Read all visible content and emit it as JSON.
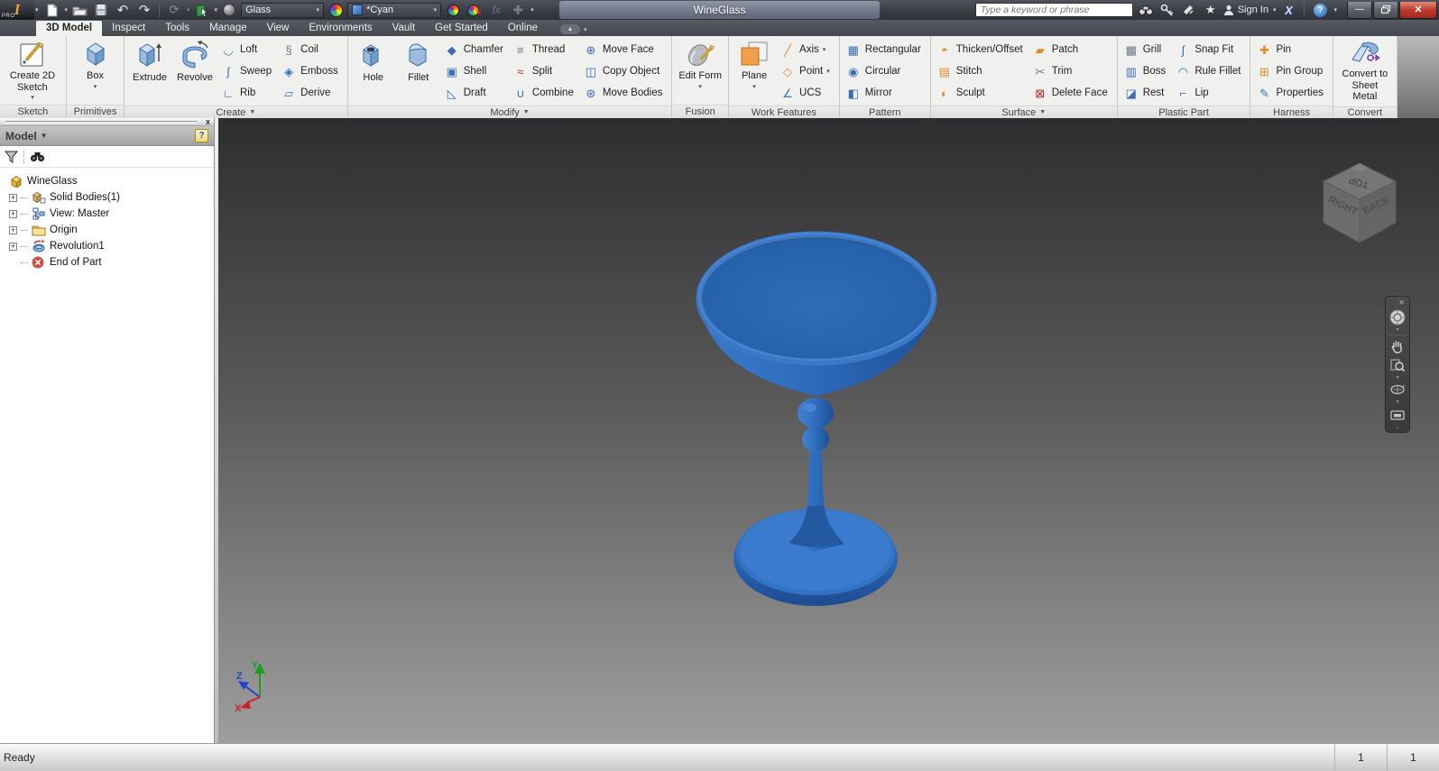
{
  "titlebar": {
    "logo": "I",
    "logo_sub": "PRO",
    "document_title": "WineGlass",
    "material_value": "Glass",
    "appearance_value": "*Cyan",
    "fx_label": "fx",
    "search_placeholder": "Type a keyword or phrase",
    "sign_in_label": "Sign In",
    "exchange_label": "X",
    "help_label": "?"
  },
  "tabs": {
    "items": [
      {
        "label": "3D Model",
        "active": true
      },
      {
        "label": "Inspect"
      },
      {
        "label": "Tools"
      },
      {
        "label": "Manage"
      },
      {
        "label": "View"
      },
      {
        "label": "Environments"
      },
      {
        "label": "Vault"
      },
      {
        "label": "Get Started"
      },
      {
        "label": "Online"
      }
    ]
  },
  "ribbon": {
    "panels": [
      {
        "label": "Sketch",
        "big": [
          {
            "label": "Create 2D Sketch",
            "icon": "create-2d-sketch-icon"
          }
        ]
      },
      {
        "label": "Primitives",
        "big": [
          {
            "label": "Box",
            "icon": "box-icon"
          }
        ]
      },
      {
        "label": "Create",
        "arrow": "▼",
        "big": [
          {
            "label": "Extrude",
            "icon": "extrude-icon"
          },
          {
            "label": "Revolve",
            "icon": "revolve-icon"
          }
        ],
        "cols": [
          [
            {
              "label": "Loft",
              "icon": "loft-icon"
            },
            {
              "label": "Sweep",
              "icon": "sweep-icon"
            },
            {
              "label": "Rib",
              "icon": "rib-icon"
            }
          ],
          [
            {
              "label": "Coil",
              "icon": "coil-icon"
            },
            {
              "label": "Emboss",
              "icon": "emboss-icon"
            },
            {
              "label": "Derive",
              "icon": "derive-icon"
            }
          ]
        ]
      },
      {
        "label": "Modify",
        "arrow": "▼",
        "big": [
          {
            "label": "Hole",
            "icon": "hole-icon"
          },
          {
            "label": "Fillet",
            "icon": "fillet-icon"
          }
        ],
        "cols": [
          [
            {
              "label": "Chamfer",
              "icon": "chamfer-icon"
            },
            {
              "label": "Shell",
              "icon": "shell-icon"
            },
            {
              "label": "Draft",
              "icon": "draft-icon"
            }
          ],
          [
            {
              "label": "Thread",
              "icon": "thread-icon"
            },
            {
              "label": "Split",
              "icon": "split-icon"
            },
            {
              "label": "Combine",
              "icon": "combine-icon"
            }
          ],
          [
            {
              "label": "Move Face",
              "icon": "move-face-icon"
            },
            {
              "label": "Copy Object",
              "icon": "copy-object-icon"
            },
            {
              "label": "Move Bodies",
              "icon": "move-bodies-icon"
            }
          ]
        ]
      },
      {
        "label": "Fusion",
        "big": [
          {
            "label": "Edit Form",
            "arrow": "▾",
            "icon": "edit-form-icon"
          }
        ]
      },
      {
        "label": "Work Features",
        "big": [
          {
            "label": "Plane",
            "arrow": "▾",
            "icon": "plane-icon"
          }
        ],
        "cols": [
          [
            {
              "label": "Axis",
              "arrow": "▾",
              "icon": "axis-icon"
            },
            {
              "label": "Point",
              "arrow": "▾",
              "icon": "point-icon"
            },
            {
              "label": "UCS",
              "icon": "ucs-icon"
            }
          ]
        ]
      },
      {
        "label": "Pattern",
        "cols": [
          [
            {
              "label": "Rectangular",
              "icon": "rectangular-pattern-icon"
            },
            {
              "label": "Circular",
              "icon": "circular-pattern-icon"
            },
            {
              "label": "Mirror",
              "icon": "mirror-icon"
            }
          ]
        ]
      },
      {
        "label": "Surface",
        "arrow": "▼",
        "cols": [
          [
            {
              "label": "Thicken/Offset",
              "icon": "thicken-offset-icon"
            },
            {
              "label": "Stitch",
              "icon": "stitch-icon"
            },
            {
              "label": "Sculpt",
              "icon": "sculpt-icon"
            }
          ],
          [
            {
              "label": "Patch",
              "icon": "patch-icon"
            },
            {
              "label": "Trim",
              "icon": "trim-icon"
            },
            {
              "label": "Delete Face",
              "icon": "delete-face-icon"
            }
          ]
        ]
      },
      {
        "label": "Plastic Part",
        "cols": [
          [
            {
              "label": "Grill",
              "icon": "grill-icon"
            },
            {
              "label": "Boss",
              "icon": "boss-icon"
            },
            {
              "label": "Rest",
              "icon": "rest-icon"
            }
          ],
          [
            {
              "label": "Snap Fit",
              "icon": "snap-fit-icon"
            },
            {
              "label": "Rule Fillet",
              "icon": "rule-fillet-icon"
            },
            {
              "label": "Lip",
              "icon": "lip-icon"
            }
          ]
        ]
      },
      {
        "label": "Harness",
        "cols": [
          [
            {
              "label": "Pin",
              "icon": "pin-icon"
            },
            {
              "label": "Pin Group",
              "icon": "pin-group-icon"
            },
            {
              "label": "Properties",
              "icon": "properties-icon"
            }
          ]
        ]
      },
      {
        "label": "Convert",
        "big": [
          {
            "label": "Convert to Sheet Metal",
            "icon": "convert-sheet-metal-icon"
          }
        ]
      }
    ]
  },
  "browser": {
    "header": "Model",
    "tree": [
      {
        "label": "WineGlass",
        "icon": "part-icon"
      },
      {
        "label": "Solid Bodies(1)",
        "icon": "solid-bodies-icon"
      },
      {
        "label": "View: Master",
        "icon": "view-rep-icon"
      },
      {
        "label": "Origin",
        "icon": "folder-icon"
      },
      {
        "label": "Revolution1",
        "icon": "revolution-icon"
      },
      {
        "label": "End of Part",
        "icon": "end-of-part-icon"
      }
    ]
  },
  "viewport": {
    "viewcube": {
      "top": "TOP",
      "left": "RIGHT",
      "right": "BACK"
    },
    "triad": {
      "x": "X",
      "y": "Y",
      "z": "Z"
    },
    "model_color": "#2e6cbd"
  },
  "statusbar": {
    "message": "Ready",
    "count1": "1",
    "count2": "1"
  }
}
